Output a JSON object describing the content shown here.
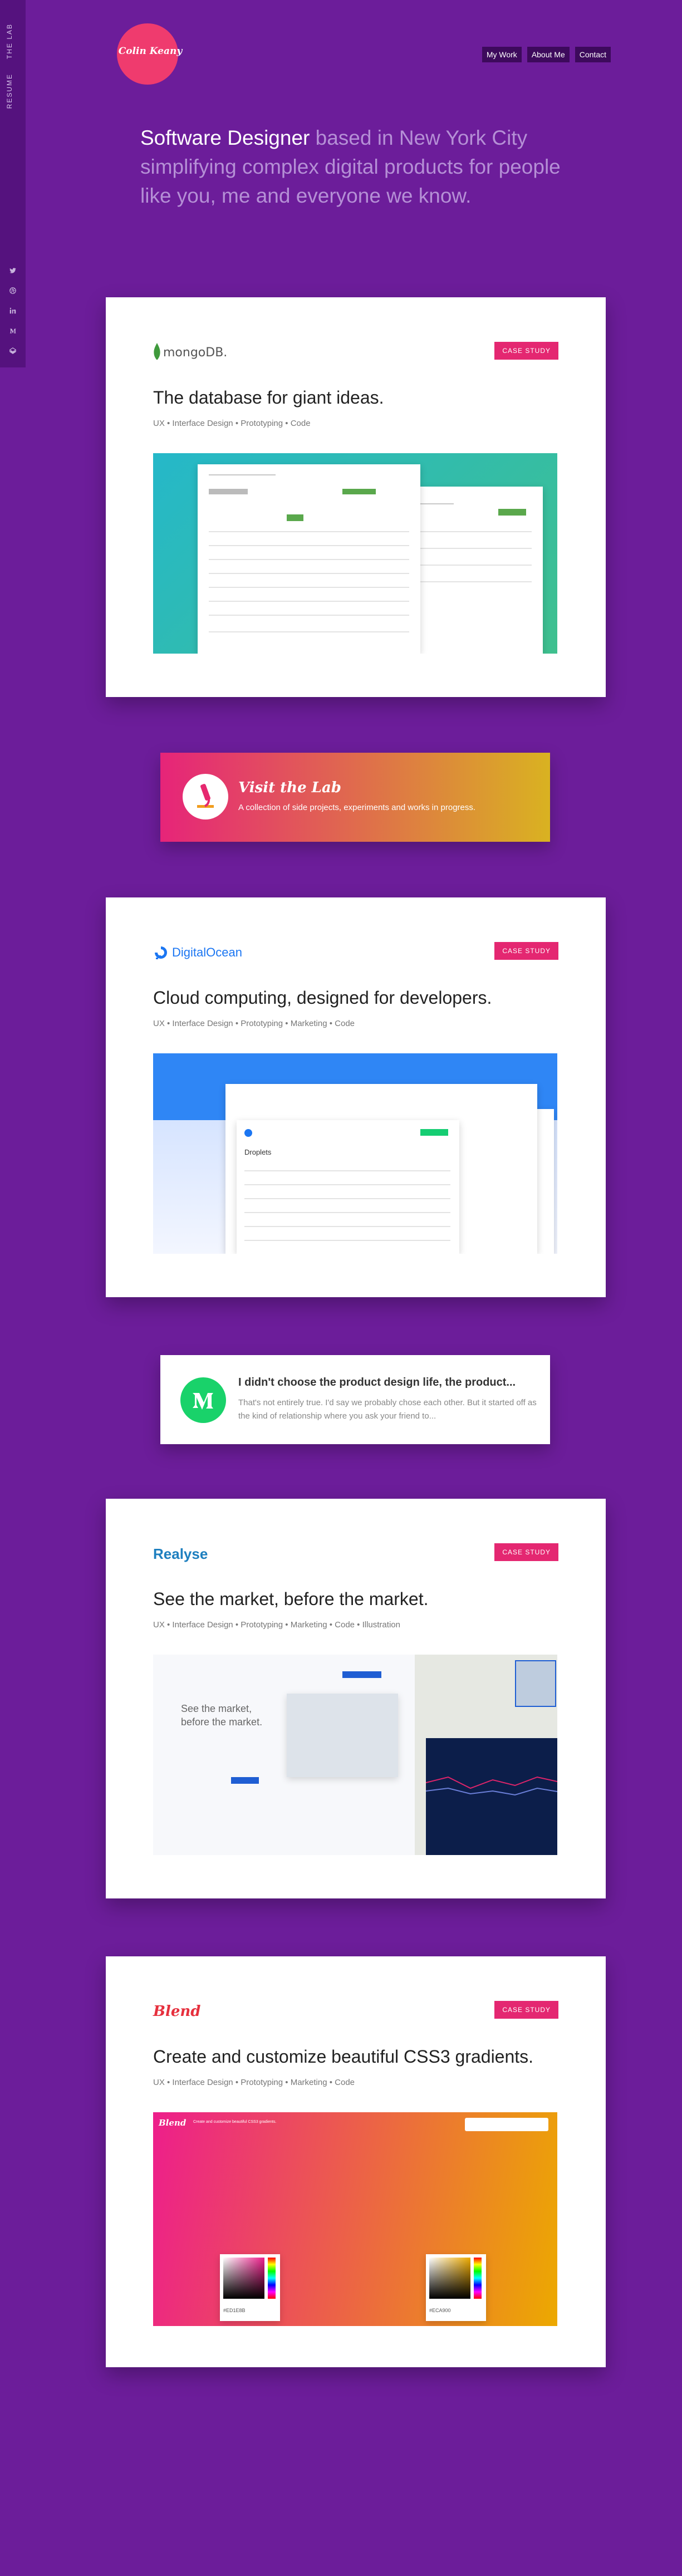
{
  "side_nav": {
    "lab": "The Lab",
    "resume": "Resume"
  },
  "social": [
    "twitter-icon",
    "dribbble-icon",
    "linkedin-icon",
    "medium-icon",
    "codepen-icon"
  ],
  "logo": {
    "text": "Colin Keany"
  },
  "nav": {
    "work": "My Work",
    "about": "About Me",
    "contact": "Contact"
  },
  "intro": {
    "highlight": "Software Designer",
    "rest": " based in New York City simplifying complex digital products for people like you, me and everyone we know."
  },
  "cta": "Case Study",
  "projects": [
    {
      "brand": "mongoDB.",
      "title": "The database for giant ideas.",
      "tags": "UX • Interface Design • Prototyping • Code"
    },
    {
      "brand": "DigitalOcean",
      "title": "Cloud computing, designed for developers.",
      "tags": "UX • Interface Design • Prototyping • Marketing • Code",
      "shot_heading": "Droplets"
    },
    {
      "brand": "Realyse",
      "title": "See the market, before the market.",
      "tags": "UX • Interface Design • Prototyping • Marketing • Code • Illustration",
      "shot_heading": "See the market, before the market."
    },
    {
      "brand": "Blend",
      "title": "Create and customize beautiful CSS3 gradients.",
      "tags": "UX • Interface Design • Prototyping • Marketing • Code",
      "app_name": "Blend",
      "app_tag": "Create and customize beautiful CSS3 gradients.",
      "color_left": "#ED1E8B",
      "color_right": "#ECA900"
    }
  ],
  "lab": {
    "title": "Visit the Lab",
    "subtitle": "A collection of side projects, experiments and works in progress."
  },
  "medium": {
    "title": "I didn't choose the product design life, the product...",
    "body": "That's not entirely true. I'd say we probably chose each other. But it started off as the kind of relationship where you ask your friend to..."
  },
  "colors": {
    "background": "#6C1D9A",
    "accent": "#E42771",
    "medium_green": "#19D26A"
  }
}
